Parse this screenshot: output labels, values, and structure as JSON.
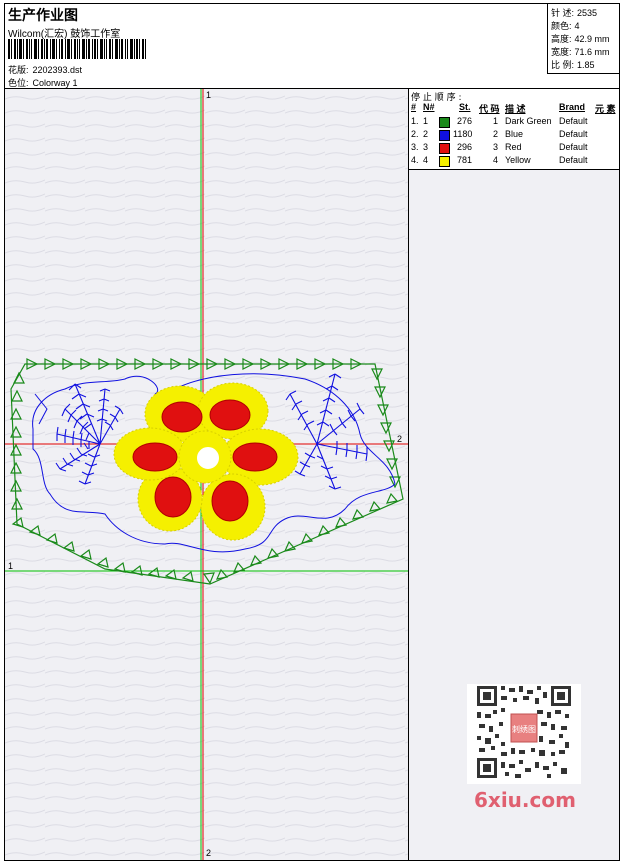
{
  "header": {
    "title": "生产作业图",
    "company": "Wilcom(汇宏) 鼓饰工作室",
    "design_label": "花版:",
    "design_value": "2202393.dst",
    "colorway_label": "色位:",
    "colorway_value": "Colorway 1"
  },
  "stats": {
    "stitches_label": "针 述:",
    "stitches_value": "2535",
    "colors_label": "颜色:",
    "colors_value": "4",
    "height_label": "高度:",
    "height_value": "42.9 mm",
    "width_label": "宽度:",
    "width_value": "71.6 mm",
    "scale_label": "比 例:",
    "scale_value": "1.85"
  },
  "stop_sequence": {
    "title": "停 止 顺 序 :",
    "headers": [
      "#",
      "N#",
      "St.",
      "代 码",
      "描 述",
      "Brand",
      "元 素"
    ],
    "rows": [
      {
        "idx": "1.",
        "n": "1",
        "st": "276",
        "code": "1",
        "desc": "Dark Green",
        "brand": "Default",
        "color": "#1a8a1a"
      },
      {
        "idx": "2.",
        "n": "2",
        "st": "1180",
        "code": "2",
        "desc": "Blue",
        "brand": "Default",
        "color": "#1010e0"
      },
      {
        "idx": "3.",
        "n": "3",
        "st": "296",
        "code": "3",
        "desc": "Red",
        "brand": "Default",
        "color": "#e01010"
      },
      {
        "idx": "4.",
        "n": "4",
        "st": "781",
        "code": "4",
        "desc": "Yellow",
        "brand": "Default",
        "color": "#f5f000"
      }
    ]
  },
  "axes": {
    "v_top": "1",
    "v_bottom": "2",
    "h_left": "1",
    "h_right": "2"
  },
  "watermark": {
    "logo_text": "6xiu.com",
    "stamp_text": "刺绣图"
  },
  "colors": {
    "green": "#1a8a1a",
    "blue": "#1010e0",
    "red": "#e01010",
    "yellow": "#f5f000",
    "axis_green": "#00c000",
    "axis_red": "#e00000"
  }
}
